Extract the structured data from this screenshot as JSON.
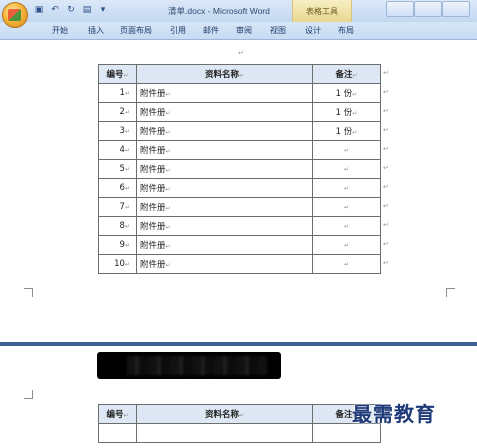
{
  "titlebar": {
    "doc_title": "清单.docx - Microsoft Word",
    "context_tab": "表格工具",
    "qat_icons": [
      "save-icon",
      "undo-icon",
      "redo-icon",
      "print-preview-icon",
      "customize-icon"
    ]
  },
  "ribbon": {
    "tabs": [
      "开始",
      "插入",
      "页面布局",
      "引用",
      "邮件",
      "审阅",
      "视图",
      "设计",
      "布局"
    ]
  },
  "table": {
    "headers": [
      "编号",
      "资料名称",
      "备注"
    ],
    "rows": [
      {
        "num": "1",
        "name": "附件册",
        "note": "1 份"
      },
      {
        "num": "2",
        "name": "附件册",
        "note": "1 份"
      },
      {
        "num": "3",
        "name": "附件册",
        "note": "1 份"
      },
      {
        "num": "4",
        "name": "附件册",
        "note": ""
      },
      {
        "num": "5",
        "name": "附件册",
        "note": ""
      },
      {
        "num": "6",
        "name": "附件册",
        "note": ""
      },
      {
        "num": "7",
        "name": "附件册",
        "note": ""
      },
      {
        "num": "8",
        "name": "附件册",
        "note": ""
      },
      {
        "num": "9",
        "name": "附件册",
        "note": ""
      },
      {
        "num": "10",
        "name": "附件册",
        "note": ""
      }
    ]
  },
  "table2": {
    "headers": [
      "编号",
      "资料名称",
      "备注"
    ]
  },
  "marks": {
    "paragraph": "↵"
  },
  "watermark": "最需教育",
  "colors": {
    "header_fill": "#dde8f4",
    "page_break": "#3d5f8f",
    "ribbon": "#c7dbf3"
  }
}
